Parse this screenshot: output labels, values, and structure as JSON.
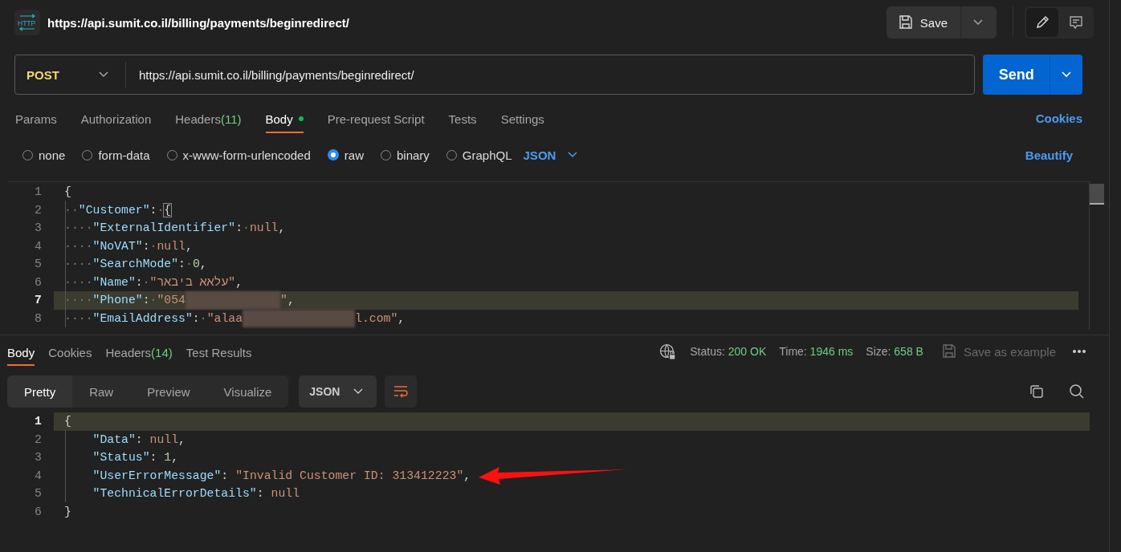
{
  "header": {
    "logo_text": "HTTP",
    "title": "https://api.sumit.co.il/billing/payments/beginredirect/",
    "save_label": "Save"
  },
  "request": {
    "method": "POST",
    "url": "https://api.sumit.co.il/billing/payments/beginredirect/",
    "send_label": "Send"
  },
  "request_tabs": [
    {
      "label": "Params",
      "selected": false
    },
    {
      "label": "Authorization",
      "selected": false
    },
    {
      "label": "Headers",
      "count": "(11)",
      "selected": false
    },
    {
      "label": "Body",
      "selected": true,
      "has_content": true
    },
    {
      "label": "Pre-request Script",
      "selected": false
    },
    {
      "label": "Tests",
      "selected": false
    },
    {
      "label": "Settings",
      "selected": false
    }
  ],
  "cookies_link": "Cookies",
  "body_types": [
    {
      "label": "none",
      "selected": false
    },
    {
      "label": "form-data",
      "selected": false
    },
    {
      "label": "x-www-form-urlencoded",
      "selected": false
    },
    {
      "label": "raw",
      "selected": true
    },
    {
      "label": "binary",
      "selected": false
    },
    {
      "label": "GraphQL",
      "selected": false
    }
  ],
  "body_format": "JSON",
  "beautify_link": "Beautify",
  "request_code": [
    {
      "number": "1",
      "current": false,
      "tokens": [
        {
          "kind": "punct",
          "text": "{"
        }
      ]
    },
    {
      "number": "2",
      "current": false,
      "tokens": [
        {
          "kind": "ws",
          "text": "··"
        },
        {
          "kind": "key",
          "text": "\"Customer\""
        },
        {
          "kind": "punct",
          "text": ":"
        },
        {
          "kind": "ws",
          "text": "·"
        },
        {
          "kind": "bracket",
          "text": "{"
        }
      ]
    },
    {
      "number": "3",
      "current": false,
      "tokens": [
        {
          "kind": "ws",
          "text": "····"
        },
        {
          "kind": "key",
          "text": "\"ExternalIdentifier\""
        },
        {
          "kind": "punct",
          "text": ":"
        },
        {
          "kind": "ws",
          "text": "·"
        },
        {
          "kind": "null",
          "text": "null"
        },
        {
          "kind": "punct",
          "text": ","
        }
      ]
    },
    {
      "number": "4",
      "current": false,
      "tokens": [
        {
          "kind": "ws",
          "text": "····"
        },
        {
          "kind": "key",
          "text": "\"NoVAT\""
        },
        {
          "kind": "punct",
          "text": ":"
        },
        {
          "kind": "ws",
          "text": "·"
        },
        {
          "kind": "null",
          "text": "null"
        },
        {
          "kind": "punct",
          "text": ","
        }
      ]
    },
    {
      "number": "5",
      "current": false,
      "tokens": [
        {
          "kind": "ws",
          "text": "····"
        },
        {
          "kind": "key",
          "text": "\"SearchMode\""
        },
        {
          "kind": "punct",
          "text": ":"
        },
        {
          "kind": "ws",
          "text": "·"
        },
        {
          "kind": "number",
          "text": "0"
        },
        {
          "kind": "punct",
          "text": ","
        }
      ]
    },
    {
      "number": "6",
      "current": false,
      "tokens": [
        {
          "kind": "ws",
          "text": "····"
        },
        {
          "kind": "key",
          "text": "\"Name\""
        },
        {
          "kind": "punct",
          "text": ":"
        },
        {
          "kind": "ws",
          "text": "·"
        },
        {
          "kind": "string",
          "text": "\"עלאא ביבאר\""
        },
        {
          "kind": "punct",
          "text": ","
        }
      ]
    },
    {
      "number": "7",
      "current": true,
      "tokens": [
        {
          "kind": "ws",
          "text": "····"
        },
        {
          "kind": "key",
          "text": "\"Phone\""
        },
        {
          "kind": "punct",
          "text": ":"
        },
        {
          "kind": "ws",
          "text": "·"
        },
        {
          "kind": "string",
          "text": "\"054"
        },
        {
          "kind": "redacted"
        },
        {
          "kind": "string",
          "text": "\""
        },
        {
          "kind": "punct",
          "text": ","
        }
      ]
    },
    {
      "number": "8",
      "current": false,
      "tokens": [
        {
          "kind": "ws",
          "text": "····"
        },
        {
          "kind": "key",
          "text": "\"EmailAddress\""
        },
        {
          "kind": "punct",
          "text": ":"
        },
        {
          "kind": "ws",
          "text": "·"
        },
        {
          "kind": "string",
          "text": "\"alaa"
        },
        {
          "kind": "redacted"
        },
        {
          "kind": "string",
          "text": "l.com\""
        },
        {
          "kind": "punct",
          "text": ","
        }
      ]
    }
  ],
  "response_tabs": [
    {
      "label": "Body",
      "selected": true
    },
    {
      "label": "Cookies",
      "selected": false
    },
    {
      "label": "Headers",
      "count": "(14)",
      "selected": false
    },
    {
      "label": "Test Results",
      "selected": false
    }
  ],
  "response_meta": [
    {
      "label": "Status:",
      "value": "200 OK"
    },
    {
      "label": "Time:",
      "value": "1946 ms"
    },
    {
      "label": "Size:",
      "value": "658 B"
    }
  ],
  "save_example": {
    "label": "Save as example",
    "disabled": true
  },
  "view_modes": [
    {
      "label": "Pretty",
      "selected": true
    },
    {
      "label": "Raw",
      "selected": false
    },
    {
      "label": "Preview",
      "selected": false
    },
    {
      "label": "Visualize",
      "selected": false
    }
  ],
  "response_format": "JSON",
  "response_code": [
    {
      "number": "1",
      "current": true,
      "tokens": [
        {
          "kind": "punct",
          "text": "{"
        }
      ]
    },
    {
      "number": "2",
      "current": false,
      "tokens": [
        {
          "kind": "indent"
        },
        {
          "kind": "key",
          "text": "\"Data\""
        },
        {
          "kind": "punct",
          "text": ": "
        },
        {
          "kind": "null",
          "text": "null"
        },
        {
          "kind": "punct",
          "text": ","
        }
      ]
    },
    {
      "number": "3",
      "current": false,
      "tokens": [
        {
          "kind": "indent"
        },
        {
          "kind": "key",
          "text": "\"Status\""
        },
        {
          "kind": "punct",
          "text": ": "
        },
        {
          "kind": "number",
          "text": "1"
        },
        {
          "kind": "punct",
          "text": ","
        }
      ]
    },
    {
      "number": "4",
      "current": false,
      "tokens": [
        {
          "kind": "indent"
        },
        {
          "kind": "key",
          "text": "\"UserErrorMessage\""
        },
        {
          "kind": "punct",
          "text": ": "
        },
        {
          "kind": "string",
          "text": "\"Invalid Customer ID: 313412223\""
        },
        {
          "kind": "punct",
          "text": ","
        }
      ]
    },
    {
      "number": "5",
      "current": false,
      "tokens": [
        {
          "kind": "indent"
        },
        {
          "kind": "key",
          "text": "\"TechnicalErrorDetails\""
        },
        {
          "kind": "punct",
          "text": ": "
        },
        {
          "kind": "null",
          "text": "null"
        }
      ]
    },
    {
      "number": "6",
      "current": false,
      "tokens": [
        {
          "kind": "punct",
          "text": "}"
        }
      ]
    }
  ]
}
